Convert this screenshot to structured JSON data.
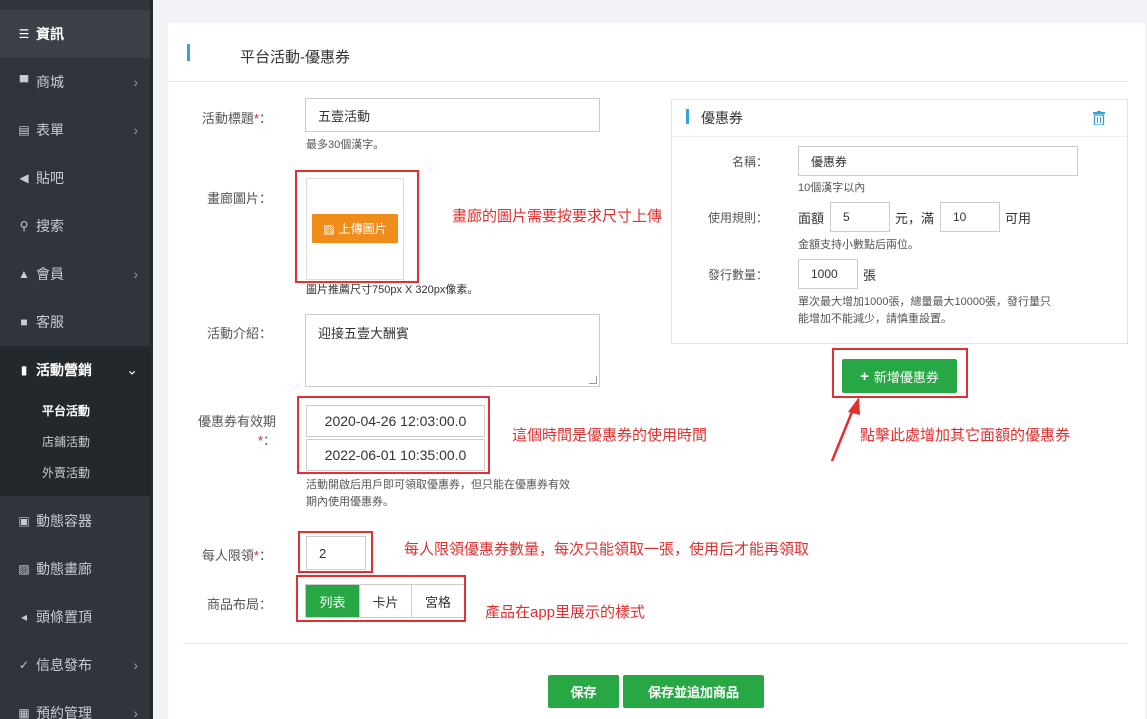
{
  "sidebar": {
    "items": [
      {
        "label": "資訊",
        "icon": "list-icon"
      },
      {
        "label": "商城",
        "icon": "cart-icon"
      },
      {
        "label": "表單",
        "icon": "form-icon"
      },
      {
        "label": "貼吧",
        "icon": "megaphone-icon"
      },
      {
        "label": "搜索",
        "icon": "search-icon"
      },
      {
        "label": "會員",
        "icon": "bell-icon"
      },
      {
        "label": "客服",
        "icon": "chat-icon"
      },
      {
        "label": "活動營銷",
        "icon": "bookmark-icon"
      },
      {
        "label": "動態容器",
        "icon": "container-icon"
      },
      {
        "label": "動態畫廊",
        "icon": "image-icon"
      },
      {
        "label": "頭條置頂",
        "icon": "volume-icon"
      },
      {
        "label": "信息發布",
        "icon": "check-icon"
      },
      {
        "label": "預約管理",
        "icon": "calendar-icon"
      }
    ],
    "subitems": [
      "平台活動",
      "店鋪活動",
      "外賣活動"
    ]
  },
  "page": {
    "title": "平台活動-優惠券"
  },
  "form": {
    "title_label": "活動標題",
    "title_value": "五壹活動",
    "title_hint": "最多30個漢字。",
    "gallery_label": "畫廊圖片：",
    "upload_btn": "上傳圖片",
    "gallery_hint": "圖片推薦尺寸750px X 320px像素。",
    "intro_label": "活動介紹：",
    "intro_value": "迎接五壹大酬賓",
    "validity_label": "優惠券有效期",
    "date_start": "2020-04-26 12:03:00.0",
    "date_end": "2022-06-01 10:35:00.0",
    "validity_hint_1": "活動開啟后用戶即可領取優惠券，但只能在優惠券有效",
    "validity_hint_2": "期內使用優惠券。",
    "limit_label": "每人限領",
    "limit_value": "2",
    "layout_label": "商品布局：",
    "layout_options": [
      "列表",
      "卡片",
      "宮格"
    ],
    "save_btn": "保存",
    "save_add_btn": "保存並追加商品",
    "colon": "："
  },
  "coupon": {
    "header": "優惠券",
    "name_label": "名稱：",
    "name_value": "優惠券",
    "name_hint": "10個漢字以內",
    "rule_label": "使用規則：",
    "face_label": "面額",
    "face_value": "5",
    "yuan_man": "元，滿",
    "min_value": "10",
    "usable": "可用",
    "rule_hint": "金額支持小數點后兩位。",
    "qty_label": "發行數量：",
    "qty_value": "1000",
    "qty_unit": "張",
    "qty_hint_1": "單次最大增加1000張，總量最大10000張，發行量只",
    "qty_hint_2": "能增加不能減少，請慎重設置。",
    "add_btn": "新增優惠券"
  },
  "annotations": {
    "gallery": "畫廊的圖片需要按要求尺寸上傳",
    "validity": "這個時間是優惠券的使用時間",
    "add_coupon": "點擊此處增加其它面額的優惠券",
    "limit": "每人限領優惠券數量，每次只能領取一張，使用后才能再領取",
    "layout": "產品在app里展示的樣式"
  },
  "colors": {
    "accent": "#28a745",
    "upload": "#f08c1a",
    "annotation": "#e03030",
    "sidebar": "#2f353b"
  }
}
